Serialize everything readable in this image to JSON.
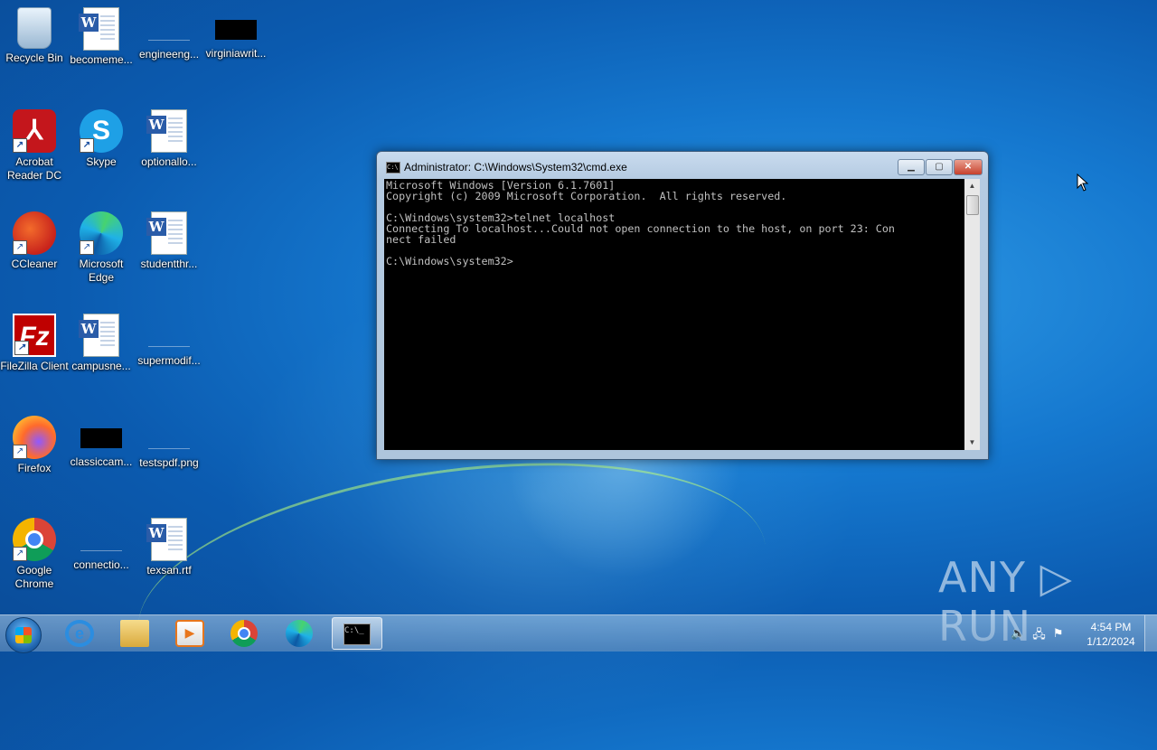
{
  "desktop": {
    "icons": [
      {
        "label": "Recycle Bin",
        "icon": "recycle-bin-icon"
      },
      {
        "label": "becomeme...",
        "icon": "word-document-icon"
      },
      {
        "label": "engineeng...",
        "icon": "blank-thumbnail-icon"
      },
      {
        "label": "virginiawrit...",
        "icon": "black-thumbnail-icon"
      },
      {
        "label": "Acrobat Reader DC",
        "icon": "acrobat-icon"
      },
      {
        "label": "Skype",
        "icon": "skype-icon"
      },
      {
        "label": "optionallo...",
        "icon": "word-document-icon"
      },
      {
        "label": "CCleaner",
        "icon": "ccleaner-icon"
      },
      {
        "label": "Microsoft Edge",
        "icon": "edge-icon"
      },
      {
        "label": "studentthr...",
        "icon": "word-document-icon"
      },
      {
        "label": "FileZilla Client",
        "icon": "filezilla-icon"
      },
      {
        "label": "campusne...",
        "icon": "word-document-icon"
      },
      {
        "label": "supermodif...",
        "icon": "blank-thumbnail-icon"
      },
      {
        "label": "Firefox",
        "icon": "firefox-icon"
      },
      {
        "label": "classiccam...",
        "icon": "black-thumbnail-icon"
      },
      {
        "label": "testspdf.png",
        "icon": "blank-thumbnail-icon"
      },
      {
        "label": "Google Chrome",
        "icon": "chrome-icon"
      },
      {
        "label": "connectio...",
        "icon": "blank-thumbnail-icon"
      },
      {
        "label": "texsan.rtf",
        "icon": "word-document-icon"
      }
    ]
  },
  "cmd_window": {
    "title": "Administrator: C:\\Windows\\System32\\cmd.exe",
    "icon_text": "C:\\",
    "minimize": "▁",
    "maximize": "▢",
    "close": "✕",
    "console_text": "Microsoft Windows [Version 6.1.7601]\nCopyright (c) 2009 Microsoft Corporation.  All rights reserved.\n\nC:\\Windows\\system32>telnet localhost\nConnecting To localhost...Could not open connection to the host, on port 23: Con\nnect failed\n\nC:\\Windows\\system32>"
  },
  "watermark": "ANY ▷ RUN",
  "taskbar": {
    "items": [
      "internet-explorer-icon",
      "file-explorer-icon",
      "media-player-icon",
      "chrome-icon",
      "edge-icon",
      "cmd-icon"
    ],
    "ie_glyph": "e",
    "media_glyph": "▶",
    "cmd_glyph": "C:\\_",
    "tray": {
      "volume": "🔈",
      "network": "🖧",
      "flag": "⚑"
    },
    "clock": {
      "time": "4:54 PM",
      "date": "1/12/2024"
    }
  }
}
